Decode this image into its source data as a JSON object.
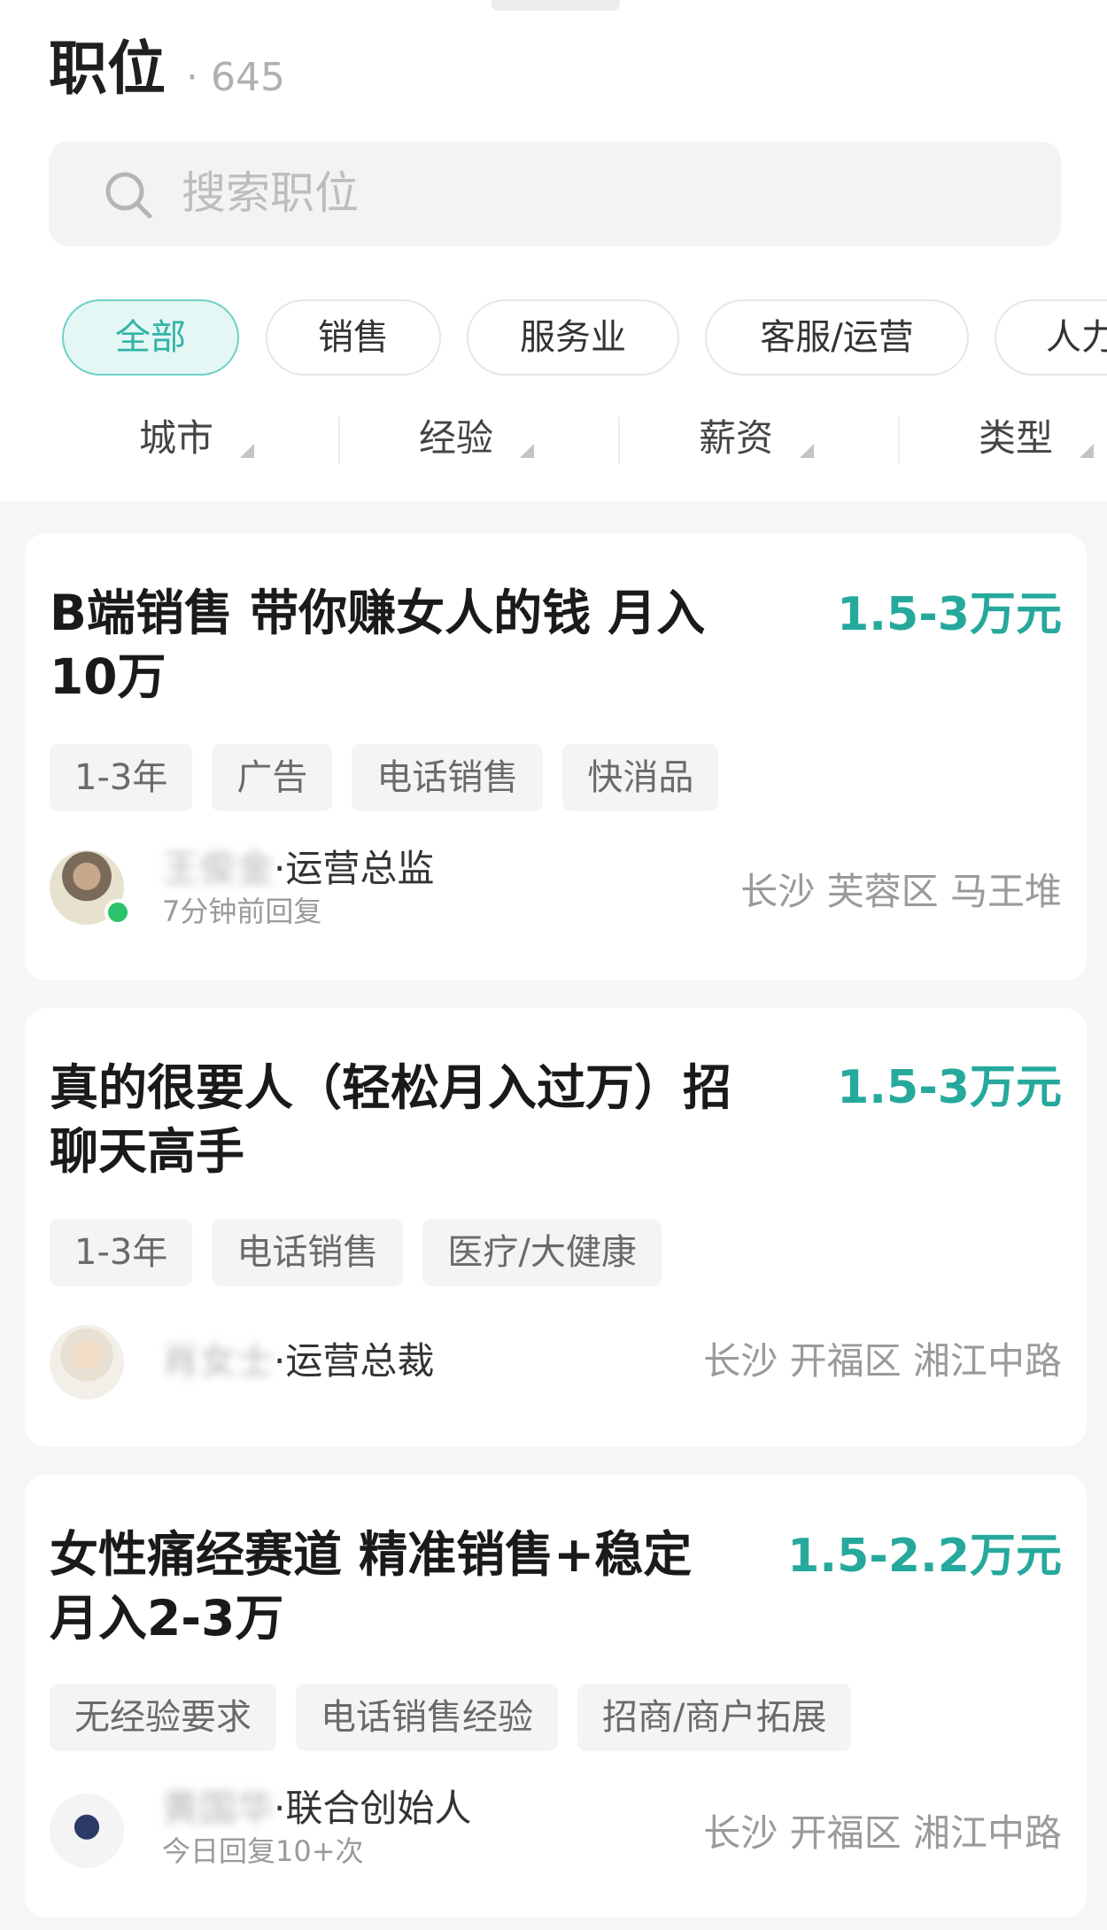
{
  "header": {
    "title": "职位",
    "count": "· 645"
  },
  "search": {
    "placeholder": "搜索职位",
    "value": ""
  },
  "categories": [
    "全部",
    "销售",
    "服务业",
    "客服/运营",
    "人力"
  ],
  "filters": [
    "城市",
    "经验",
    "薪资",
    "类型"
  ],
  "jobs": [
    {
      "title_line1": "B端销售 带你赚女人的钱 月入",
      "title_line2": "10万",
      "salary": "1.5-3万元",
      "tags": [
        "1-3年",
        "广告",
        "电话销售",
        "快消品"
      ],
      "recruiter_name": "王俊金",
      "recruiter_role": "·运营总监",
      "reply": "7分钟前回复",
      "location": "长沙 芙蓉区 马王堆"
    },
    {
      "title_line1": "真的很要人（轻松月入过万）招",
      "title_line2": "聊天高手",
      "salary": "1.5-3万元",
      "tags": [
        "1-3年",
        "电话销售",
        "医疗/大健康"
      ],
      "recruiter_name": "肖女士",
      "recruiter_role": "·运营总裁",
      "reply": "",
      "location": "长沙 开福区 湘江中路"
    },
    {
      "title_line1": "女性痛经赛道 精准销售+稳定",
      "title_line2": "月入2-3万",
      "salary": "1.5-2.2万元",
      "tags": [
        "无经验要求",
        "电话销售经验",
        "招商/商户拓展"
      ],
      "recruiter_name": "黄国华",
      "recruiter_role": "·联合创始人",
      "reply": "今日回复10+次",
      "location": "长沙 开福区 湘江中路"
    }
  ]
}
